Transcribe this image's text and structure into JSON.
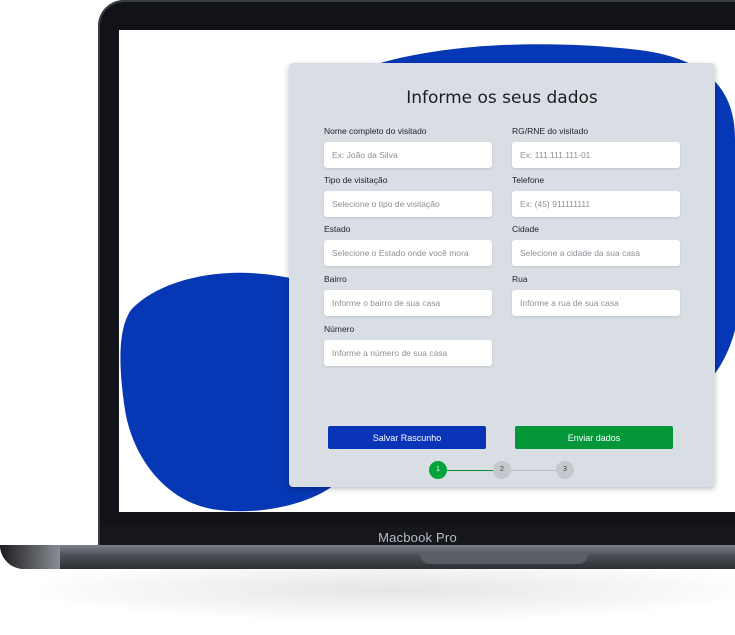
{
  "device": {
    "label": "Macbook Pro"
  },
  "colors": {
    "accent_blue": "#0a34b8",
    "accent_green": "#039739",
    "card_background": "#d8dee4",
    "blob_blue": "#0637b5"
  },
  "form": {
    "title": "Informe os seus dados",
    "fields": {
      "nome": {
        "label": "Nome completo do visitado",
        "placeholder": "Ex: João da Silva"
      },
      "rg": {
        "label": "RG/RNE do visitado",
        "placeholder": "Ex: 111.111.111-01"
      },
      "tipo": {
        "label": "Tipo de visitação",
        "placeholder": "Selecione o tipo de visitação"
      },
      "telefone": {
        "label": "Telefone",
        "placeholder": "Ex: (45) 911111111"
      },
      "estado": {
        "label": "Estado",
        "placeholder": "Selecione o Estado onde você mora"
      },
      "cidade": {
        "label": "Cidade",
        "placeholder": "Selecione a cidade da sua casa"
      },
      "bairro": {
        "label": "Bairro",
        "placeholder": "Informe o bairro de sua casa"
      },
      "rua": {
        "label": "Rua",
        "placeholder": "Informe a rua de sua casa"
      },
      "numero": {
        "label": "Número",
        "placeholder": "Informe a número de sua casa"
      }
    },
    "buttons": {
      "save": "Salvar Rascunho",
      "send": "Enviar dados"
    },
    "stepper": {
      "steps": [
        "1",
        "2",
        "3"
      ],
      "current": 1
    }
  }
}
